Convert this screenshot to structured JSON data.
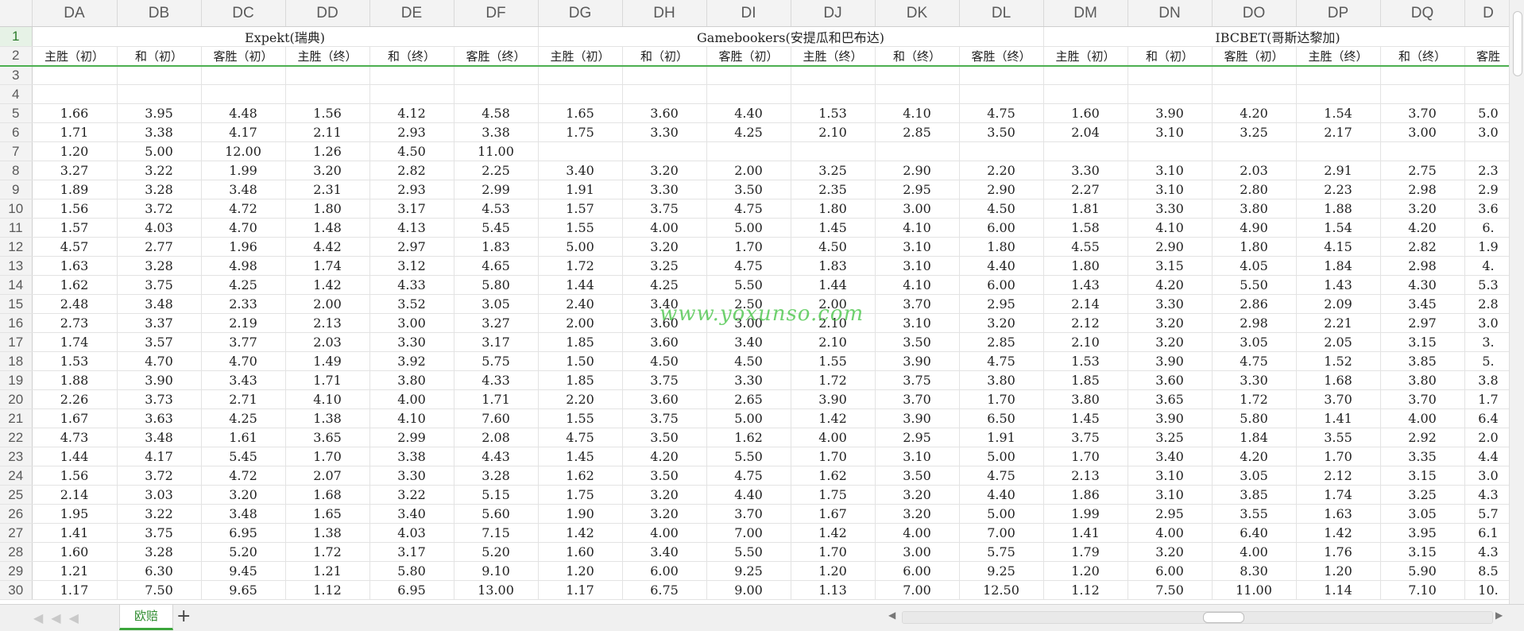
{
  "columns": [
    "DA",
    "DB",
    "DC",
    "DD",
    "DE",
    "DF",
    "DG",
    "DH",
    "DI",
    "DJ",
    "DK",
    "DL",
    "DM",
    "DN",
    "DO",
    "DP",
    "DQ",
    "D"
  ],
  "row1": {
    "number": "1",
    "groups": [
      {
        "label": "Expekt(瑞典)",
        "span": 6
      },
      {
        "label": "Gamebookers(安提瓜和巴布达)",
        "span": 6
      },
      {
        "label": "IBCBET(哥斯达黎加)",
        "span": 6
      }
    ]
  },
  "row2": {
    "number": "2",
    "cells": [
      "主胜（初）",
      "和（初）",
      "客胜（初）",
      "主胜（终）",
      "和（终）",
      "客胜（终）",
      "主胜（初）",
      "和（初）",
      "客胜（初）",
      "主胜（终）",
      "和（终）",
      "客胜（终）",
      "主胜（初）",
      "和（初）",
      "客胜（初）",
      "主胜（终）",
      "和（终）",
      "客胜"
    ]
  },
  "rows": [
    {
      "n": "3",
      "cells": [
        "",
        "",
        "",
        "",
        "",
        "",
        "",
        "",
        "",
        "",
        "",
        "",
        "",
        "",
        "",
        "",
        "",
        ""
      ]
    },
    {
      "n": "4",
      "cells": [
        "",
        "",
        "",
        "",
        "",
        "",
        "",
        "",
        "",
        "",
        "",
        "",
        "",
        "",
        "",
        "",
        "",
        ""
      ]
    },
    {
      "n": "5",
      "cells": [
        "1.66",
        "3.95",
        "4.48",
        "1.56",
        "4.12",
        "4.58",
        "1.65",
        "3.60",
        "4.40",
        "1.53",
        "4.10",
        "4.75",
        "1.60",
        "3.90",
        "4.20",
        "1.54",
        "3.70",
        "5.0"
      ]
    },
    {
      "n": "6",
      "cells": [
        "1.71",
        "3.38",
        "4.17",
        "2.11",
        "2.93",
        "3.38",
        "1.75",
        "3.30",
        "4.25",
        "2.10",
        "2.85",
        "3.50",
        "2.04",
        "3.10",
        "3.25",
        "2.17",
        "3.00",
        "3.0"
      ]
    },
    {
      "n": "7",
      "cells": [
        "1.20",
        "5.00",
        "12.00",
        "1.26",
        "4.50",
        "11.00",
        "",
        "",
        "",
        "",
        "",
        "",
        "",
        "",
        "",
        "",
        "",
        ""
      ]
    },
    {
      "n": "8",
      "cells": [
        "3.27",
        "3.22",
        "1.99",
        "3.20",
        "2.82",
        "2.25",
        "3.40",
        "3.20",
        "2.00",
        "3.25",
        "2.90",
        "2.20",
        "3.30",
        "3.10",
        "2.03",
        "2.91",
        "2.75",
        "2.3"
      ]
    },
    {
      "n": "9",
      "cells": [
        "1.89",
        "3.28",
        "3.48",
        "2.31",
        "2.93",
        "2.99",
        "1.91",
        "3.30",
        "3.50",
        "2.35",
        "2.95",
        "2.90",
        "2.27",
        "3.10",
        "2.80",
        "2.23",
        "2.98",
        "2.9"
      ]
    },
    {
      "n": "10",
      "cells": [
        "1.56",
        "3.72",
        "4.72",
        "1.80",
        "3.17",
        "4.53",
        "1.57",
        "3.75",
        "4.75",
        "1.80",
        "3.00",
        "4.50",
        "1.81",
        "3.30",
        "3.80",
        "1.88",
        "3.20",
        "3.6"
      ]
    },
    {
      "n": "11",
      "cells": [
        "1.57",
        "4.03",
        "4.70",
        "1.48",
        "4.13",
        "5.45",
        "1.55",
        "4.00",
        "5.00",
        "1.45",
        "4.10",
        "6.00",
        "1.58",
        "4.10",
        "4.90",
        "1.54",
        "4.20",
        "6."
      ]
    },
    {
      "n": "12",
      "cells": [
        "4.57",
        "2.77",
        "1.96",
        "4.42",
        "2.97",
        "1.83",
        "5.00",
        "3.20",
        "1.70",
        "4.50",
        "3.10",
        "1.80",
        "4.55",
        "2.90",
        "1.80",
        "4.15",
        "2.82",
        "1.9"
      ]
    },
    {
      "n": "13",
      "cells": [
        "1.63",
        "3.28",
        "4.98",
        "1.74",
        "3.12",
        "4.65",
        "1.72",
        "3.25",
        "4.75",
        "1.83",
        "3.10",
        "4.40",
        "1.80",
        "3.15",
        "4.05",
        "1.84",
        "2.98",
        "4."
      ]
    },
    {
      "n": "14",
      "cells": [
        "1.62",
        "3.75",
        "4.25",
        "1.42",
        "4.33",
        "5.80",
        "1.44",
        "4.25",
        "5.50",
        "1.44",
        "4.10",
        "6.00",
        "1.43",
        "4.20",
        "5.50",
        "1.43",
        "4.30",
        "5.3"
      ]
    },
    {
      "n": "15",
      "cells": [
        "2.48",
        "3.48",
        "2.33",
        "2.00",
        "3.52",
        "3.05",
        "2.40",
        "3.40",
        "2.50",
        "2.00",
        "3.70",
        "2.95",
        "2.14",
        "3.30",
        "2.86",
        "2.09",
        "3.45",
        "2.8"
      ]
    },
    {
      "n": "16",
      "cells": [
        "2.73",
        "3.37",
        "2.19",
        "2.13",
        "3.00",
        "3.27",
        "2.00",
        "3.60",
        "3.00",
        "2.10",
        "3.10",
        "3.20",
        "2.12",
        "3.20",
        "2.98",
        "2.21",
        "2.97",
        "3.0"
      ]
    },
    {
      "n": "17",
      "cells": [
        "1.74",
        "3.57",
        "3.77",
        "2.03",
        "3.30",
        "3.17",
        "1.85",
        "3.60",
        "3.40",
        "2.10",
        "3.50",
        "2.85",
        "2.10",
        "3.20",
        "3.05",
        "2.05",
        "3.15",
        "3."
      ]
    },
    {
      "n": "18",
      "cells": [
        "1.53",
        "4.70",
        "4.70",
        "1.49",
        "3.92",
        "5.75",
        "1.50",
        "4.50",
        "4.50",
        "1.55",
        "3.90",
        "4.75",
        "1.53",
        "3.90",
        "4.75",
        "1.52",
        "3.85",
        "5."
      ]
    },
    {
      "n": "19",
      "cells": [
        "1.88",
        "3.90",
        "3.43",
        "1.71",
        "3.80",
        "4.33",
        "1.85",
        "3.75",
        "3.30",
        "1.72",
        "3.75",
        "3.80",
        "1.85",
        "3.60",
        "3.30",
        "1.68",
        "3.80",
        "3.8"
      ]
    },
    {
      "n": "20",
      "cells": [
        "2.26",
        "3.73",
        "2.71",
        "4.10",
        "4.00",
        "1.71",
        "2.20",
        "3.60",
        "2.65",
        "3.90",
        "3.70",
        "1.70",
        "3.80",
        "3.65",
        "1.72",
        "3.70",
        "3.70",
        "1.7"
      ]
    },
    {
      "n": "21",
      "cells": [
        "1.67",
        "3.63",
        "4.25",
        "1.38",
        "4.10",
        "7.60",
        "1.55",
        "3.75",
        "5.00",
        "1.42",
        "3.90",
        "6.50",
        "1.45",
        "3.90",
        "5.80",
        "1.41",
        "4.00",
        "6.4"
      ]
    },
    {
      "n": "22",
      "cells": [
        "4.73",
        "3.48",
        "1.61",
        "3.65",
        "2.99",
        "2.08",
        "4.75",
        "3.50",
        "1.62",
        "4.00",
        "2.95",
        "1.91",
        "3.75",
        "3.25",
        "1.84",
        "3.55",
        "2.92",
        "2.0"
      ]
    },
    {
      "n": "23",
      "cells": [
        "1.44",
        "4.17",
        "5.45",
        "1.70",
        "3.38",
        "4.43",
        "1.45",
        "4.20",
        "5.50",
        "1.70",
        "3.10",
        "5.00",
        "1.70",
        "3.40",
        "4.20",
        "1.70",
        "3.35",
        "4.4"
      ]
    },
    {
      "n": "24",
      "cells": [
        "1.56",
        "3.72",
        "4.72",
        "2.07",
        "3.30",
        "3.28",
        "1.62",
        "3.50",
        "4.75",
        "1.62",
        "3.50",
        "4.75",
        "2.13",
        "3.10",
        "3.05",
        "2.12",
        "3.15",
        "3.0"
      ]
    },
    {
      "n": "25",
      "cells": [
        "2.14",
        "3.03",
        "3.20",
        "1.68",
        "3.22",
        "5.15",
        "1.75",
        "3.20",
        "4.40",
        "1.75",
        "3.20",
        "4.40",
        "1.86",
        "3.10",
        "3.85",
        "1.74",
        "3.25",
        "4.3"
      ]
    },
    {
      "n": "26",
      "cells": [
        "1.95",
        "3.22",
        "3.48",
        "1.65",
        "3.40",
        "5.60",
        "1.90",
        "3.20",
        "3.70",
        "1.67",
        "3.20",
        "5.00",
        "1.99",
        "2.95",
        "3.55",
        "1.63",
        "3.05",
        "5.7"
      ]
    },
    {
      "n": "27",
      "cells": [
        "1.41",
        "3.75",
        "6.95",
        "1.38",
        "4.03",
        "7.15",
        "1.42",
        "4.00",
        "7.00",
        "1.42",
        "4.00",
        "7.00",
        "1.41",
        "4.00",
        "6.40",
        "1.42",
        "3.95",
        "6.1"
      ]
    },
    {
      "n": "28",
      "cells": [
        "1.60",
        "3.28",
        "5.20",
        "1.72",
        "3.17",
        "5.20",
        "1.60",
        "3.40",
        "5.50",
        "1.70",
        "3.00",
        "5.75",
        "1.79",
        "3.20",
        "4.00",
        "1.76",
        "3.15",
        "4.3"
      ]
    },
    {
      "n": "29",
      "cells": [
        "1.21",
        "6.30",
        "9.45",
        "1.21",
        "5.80",
        "9.10",
        "1.20",
        "6.00",
        "9.25",
        "1.20",
        "6.00",
        "9.25",
        "1.20",
        "6.00",
        "8.30",
        "1.20",
        "5.90",
        "8.5"
      ]
    },
    {
      "n": "30",
      "cells": [
        "1.17",
        "7.50",
        "9.65",
        "1.12",
        "6.95",
        "13.00",
        "1.17",
        "6.75",
        "9.00",
        "1.13",
        "7.00",
        "12.50",
        "1.12",
        "7.50",
        "11.00",
        "1.14",
        "7.10",
        "10."
      ]
    }
  ],
  "watermark": "www.yoxunso.com",
  "sheet_tab": "欧赔",
  "add_sheet_symbol": "+",
  "colors": {
    "accent_green": "#3aa53a",
    "header_bg": "#f3f3f3",
    "grid": "#e3e3e3"
  }
}
